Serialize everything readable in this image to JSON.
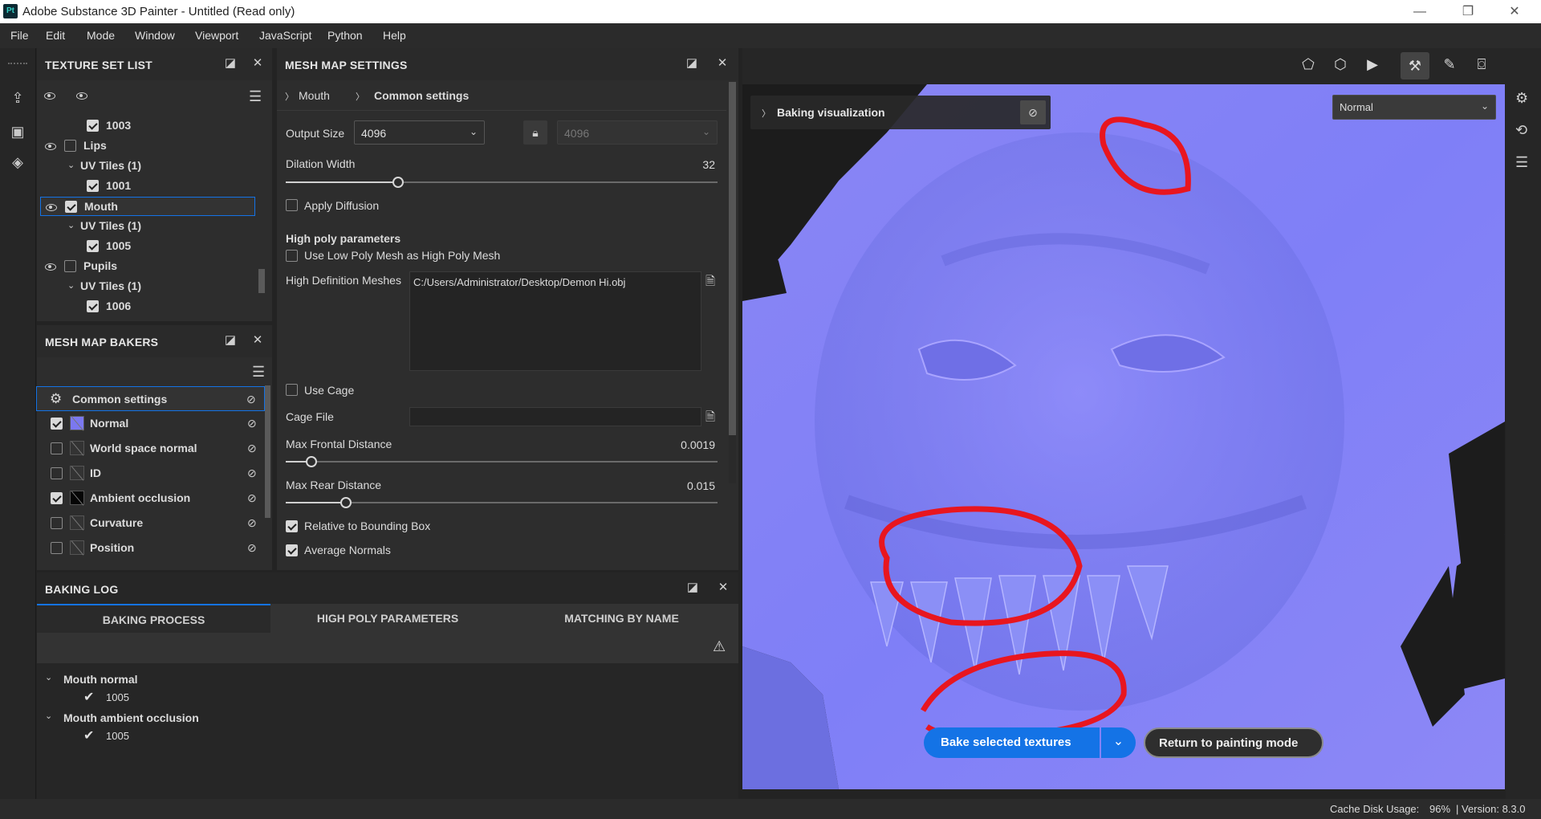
{
  "window": {
    "title": "Adobe Substance 3D Painter - Untitled (Read only)",
    "logo": "Pt",
    "minimize_icon": "—",
    "maximize_icon": "❐",
    "close_icon": "✕"
  },
  "menu": [
    "File",
    "Edit",
    "Mode",
    "Window",
    "Viewport",
    "JavaScript",
    "Python",
    "Help"
  ],
  "texture_set_list": {
    "title": "TEXTURE SET LIST",
    "rows": [
      {
        "label": "1003",
        "level": 2,
        "checked": true,
        "eye": false,
        "chevron": false
      },
      {
        "label": "Lips",
        "level": 0,
        "checked": false,
        "eye": true,
        "chevron": false
      },
      {
        "label": "UV Tiles (1)",
        "level": 1,
        "checked": null,
        "eye": false,
        "chevron": true
      },
      {
        "label": "1001",
        "level": 2,
        "checked": true,
        "eye": false,
        "chevron": false
      },
      {
        "label": "Mouth",
        "level": 0,
        "checked": true,
        "eye": true,
        "chevron": false,
        "selected": true
      },
      {
        "label": "UV Tiles (1)",
        "level": 1,
        "checked": null,
        "eye": false,
        "chevron": true
      },
      {
        "label": "1005",
        "level": 2,
        "checked": true,
        "eye": false,
        "chevron": false
      },
      {
        "label": "Pupils",
        "level": 0,
        "checked": false,
        "eye": true,
        "chevron": false
      },
      {
        "label": "UV Tiles (1)",
        "level": 1,
        "checked": null,
        "eye": false,
        "chevron": true
      },
      {
        "label": "1006",
        "level": 2,
        "checked": true,
        "eye": false,
        "chevron": false
      }
    ]
  },
  "mesh_map_bakers": {
    "title": "MESH MAP BAKERS",
    "rows": [
      {
        "label": "Common settings",
        "checked": null,
        "selected": true
      },
      {
        "label": "Normal",
        "checked": true
      },
      {
        "label": "World space normal",
        "checked": false
      },
      {
        "label": "ID",
        "checked": false
      },
      {
        "label": "Ambient occlusion",
        "checked": true
      },
      {
        "label": "Curvature",
        "checked": false
      },
      {
        "label": "Position",
        "checked": false
      }
    ]
  },
  "mesh_map_settings": {
    "title": "MESH MAP SETTINGS",
    "breadcrumb": [
      "Mouth",
      "Common settings"
    ],
    "output_size_label": "Output Size",
    "output_size_value": "4096",
    "output_size_locked_value": "4096",
    "dilation_width_label": "Dilation Width",
    "dilation_width_value": "32",
    "dilation_fraction": 0.26,
    "apply_diffusion_label": "Apply Diffusion",
    "high_poly_header": "High poly parameters",
    "use_low_poly_label": "Use Low Poly Mesh as High Poly Mesh",
    "high_def_meshes_label": "High Definition Meshes",
    "high_def_meshes_value": "C:/Users/Administrator/Desktop/Demon Hi.obj",
    "use_cage_label": "Use Cage",
    "cage_file_label": "Cage File",
    "max_frontal_label": "Max Frontal Distance",
    "max_frontal_value": "0.0019",
    "max_frontal_fraction": 0.06,
    "max_rear_label": "Max Rear Distance",
    "max_rear_value": "0.015",
    "max_rear_fraction": 0.14,
    "relative_bbox_label": "Relative to Bounding Box",
    "average_normals_label": "Average Normals"
  },
  "baking_log": {
    "title": "BAKING LOG",
    "tabs": [
      "BAKING PROCESS",
      "HIGH POLY PARAMETERS",
      "MATCHING BY NAME"
    ],
    "entries": [
      {
        "name": "Mouth normal",
        "tile": "1005"
      },
      {
        "name": "Mouth ambient occlusion",
        "tile": "1005"
      }
    ]
  },
  "viewport": {
    "baking_visualization": "Baking visualization",
    "channel_select": "Normal",
    "bake_button": "Bake selected textures",
    "return_button": "Return to painting mode",
    "accent": "#1473e6"
  },
  "status": {
    "cache": "Cache Disk Usage:",
    "cache_value": "96%",
    "version": "| Version: 8.3.0"
  }
}
